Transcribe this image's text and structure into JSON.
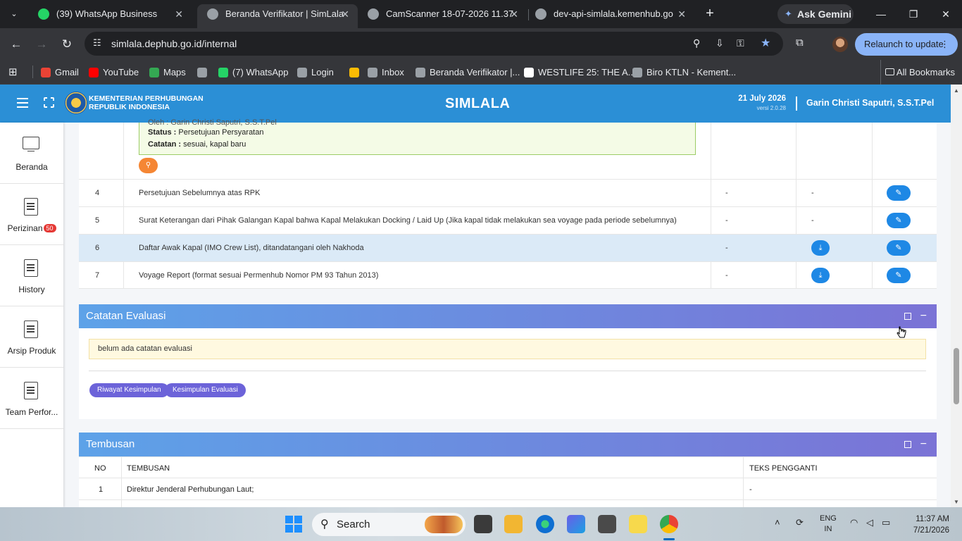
{
  "browser": {
    "tabs": [
      {
        "title": "(39) WhatsApp Business",
        "favicon_color": "#25d366"
      },
      {
        "title": "Beranda Verifikator | SimLala",
        "favicon_color": "#9aa0a6"
      },
      {
        "title": "CamScanner 18-07-2026 11.37",
        "favicon_color": "#9aa0a6"
      },
      {
        "title": "dev-api-simlala.kemenhub.go.id",
        "favicon_color": "#9aa0a6"
      }
    ],
    "gemini_label": "Ask Gemini",
    "url": "simlala.dephub.go.id/internal",
    "relaunch_label": "Relaunch to update",
    "bookmarks": [
      {
        "label": "Gmail",
        "color": "#ea4335"
      },
      {
        "label": "YouTube",
        "color": "#ff0000"
      },
      {
        "label": "Maps",
        "color": "#34a853"
      },
      {
        "label": "",
        "color": "#9aa0a6"
      },
      {
        "label": "(7) WhatsApp",
        "color": "#25d366"
      },
      {
        "label": "Login",
        "color": "#9aa0a6"
      },
      {
        "label": "",
        "color": "#fbbc04"
      },
      {
        "label": "Inbox",
        "color": "#9aa0a6"
      },
      {
        "label": "Beranda Verifikator |...",
        "color": "#9aa0a6"
      },
      {
        "label": "WESTLIFE 25: THE A...",
        "color": "#ffffff"
      },
      {
        "label": "Biro KTLN - Kement...",
        "color": "#9aa0a6"
      }
    ],
    "all_bookmarks_label": "All Bookmarks"
  },
  "header": {
    "ministry_line1": "KEMENTERIAN PERHUBUNGAN",
    "ministry_line2": "REPUBLIK INDONESIA",
    "app_title": "SIMLALA",
    "date": "21 July 2026",
    "version": "versi 2.0.28",
    "user": "Garin Christi Saputri, S.S.T.Pel"
  },
  "sidebar": {
    "items": [
      {
        "label": "Beranda",
        "icon": "monitor-icon"
      },
      {
        "label": "Perizinan",
        "icon": "document-icon",
        "badge": "50"
      },
      {
        "label": "History",
        "icon": "document-icon"
      },
      {
        "label": "Arsip Produk",
        "icon": "document-icon"
      },
      {
        "label": "Team Perfor...",
        "icon": "document-icon"
      }
    ]
  },
  "requirements": {
    "note": {
      "oleh_line": "Oleh : Garin Christi Saputri, S.S.T.Pel",
      "status_label": "Status :",
      "status_value": "Persetujuan Persyaratan",
      "catatan_label": "Catatan :",
      "catatan_value": "sesuai, kapal baru"
    },
    "rows": [
      {
        "no": "4",
        "desc": "Persetujuan Sebelumnya atas RPK",
        "col2": "-",
        "col3": "-",
        "download": false
      },
      {
        "no": "5",
        "desc": "Surat Keterangan dari Pihak Galangan Kapal bahwa Kapal Melakukan Docking / Laid Up (Jika kapal tidak melakukan sea voyage pada periode sebelumnya)",
        "col2": "-",
        "col3": "-",
        "download": false
      },
      {
        "no": "6",
        "desc": "Daftar Awak Kapal (IMO Crew List), ditandatangani oleh Nakhoda",
        "col2": "-",
        "col3": "",
        "download": true
      },
      {
        "no": "7",
        "desc": "Voyage Report (format sesuai Permenhub Nomor PM 93 Tahun 2013)",
        "col2": "-",
        "col3": "",
        "download": true
      }
    ]
  },
  "evaluation": {
    "title": "Catatan Evaluasi",
    "note": "belum ada catatan evaluasi",
    "btn_riwayat": "Riwayat Kesimpulan",
    "btn_kesimpulan": "Kesimpulan Evaluasi"
  },
  "tembusan": {
    "title": "Tembusan",
    "columns": [
      "NO",
      "TEMBUSAN",
      "TEKS PENGGANTI"
    ],
    "rows": [
      {
        "no": "1",
        "tembusan": "Direktur Jenderal Perhubungan Laut;",
        "teks": "-"
      }
    ]
  },
  "taskbar": {
    "search_placeholder": "Search",
    "lang_line1": "ENG",
    "lang_line2": "IN",
    "time": "11:37 AM",
    "date": "7/21/2026"
  },
  "colors": {
    "header_blue": "#2b8fd6",
    "button_blue": "#1e88e5",
    "pill_purple": "#6c63d9",
    "search_orange": "#f58634"
  }
}
